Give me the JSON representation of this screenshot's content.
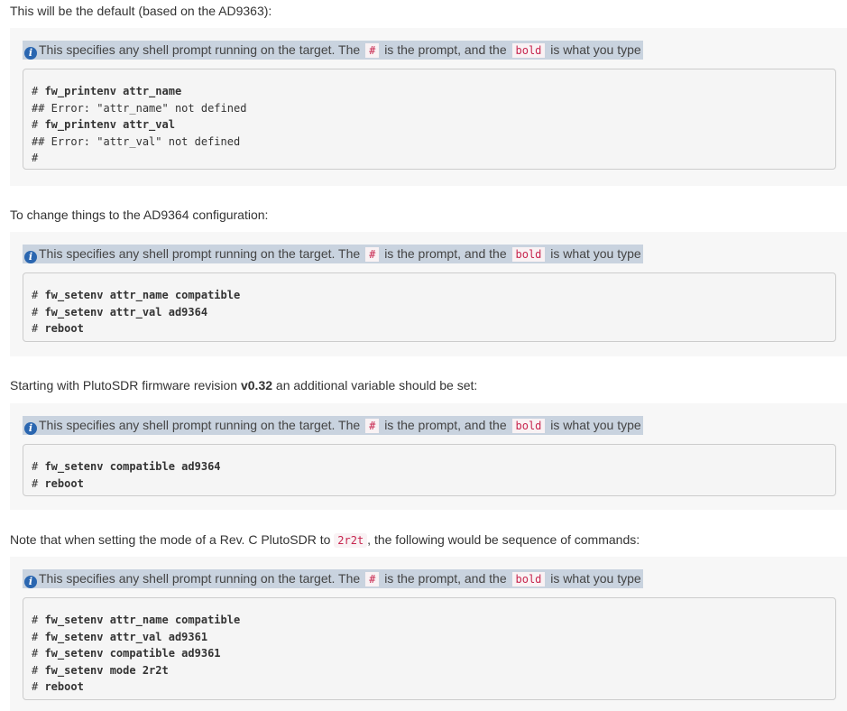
{
  "notice": {
    "prefix": "This specifies any shell prompt running on the target. The",
    "prompt_symbol": "#",
    "middle": "is the prompt, and the",
    "bold_word": "bold",
    "suffix": "is what you type"
  },
  "sections": [
    {
      "intro": "This will be the default (based on the AD9363):",
      "lines": [
        {
          "text": "# fw_printenv attr_name",
          "type": "cmd"
        },
        {
          "text": "## Error: \"attr_name\" not defined",
          "type": "out"
        },
        {
          "text": "# fw_printenv attr_val",
          "type": "cmd"
        },
        {
          "text": "## Error: \"attr_val\" not defined",
          "type": "out"
        },
        {
          "text": "#",
          "type": "out"
        }
      ]
    },
    {
      "intro": "To change things to the AD9364 configuration:",
      "lines": [
        {
          "text": "# fw_setenv attr_name compatible",
          "type": "cmd"
        },
        {
          "text": "# fw_setenv attr_val ad9364",
          "type": "cmd"
        },
        {
          "text": "# reboot",
          "type": "cmd"
        }
      ]
    },
    {
      "intro_before": "Starting with PlutoSDR firmware revision",
      "intro_bold": "v0.32",
      "intro_after": "an additional variable should be set:",
      "lines": [
        {
          "text": "# fw_setenv compatible ad9364",
          "type": "cmd"
        },
        {
          "text": "# reboot",
          "type": "cmd"
        }
      ]
    },
    {
      "intro_before": "Note that when setting the mode of a Rev. C PlutoSDR to",
      "intro_code": "2r2t",
      "intro_after": ", the following would be sequence of commands:",
      "lines": [
        {
          "text": "# fw_setenv attr_name compatible",
          "type": "cmd"
        },
        {
          "text": "# fw_setenv attr_val ad9361",
          "type": "cmd"
        },
        {
          "text": "# fw_setenv compatible ad9361",
          "type": "cmd"
        },
        {
          "text": "# fw_setenv mode 2r2t",
          "type": "cmd"
        },
        {
          "text": "# reboot",
          "type": "cmd"
        }
      ]
    }
  ]
}
